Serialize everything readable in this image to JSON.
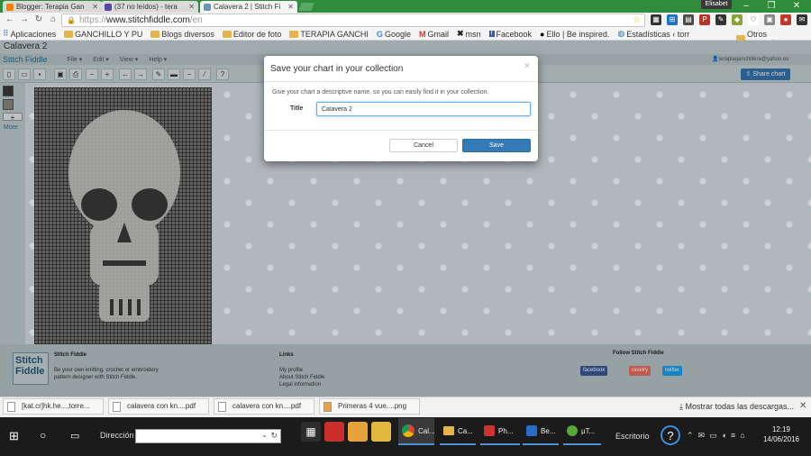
{
  "browser": {
    "tabs": [
      {
        "title": "Blogger: Terapia Gan",
        "color": "#f57d00"
      },
      {
        "title": "(37 no leídos) - tera",
        "color": "#5a46a8"
      },
      {
        "title": "Calavera 2 | Stitch Fi",
        "color": "#6a95b5"
      },
      {
        "title": "",
        "color": "#888"
      }
    ],
    "profile_name": "Elisabet",
    "url_scheme": "https://",
    "url_host": "www.stitchfiddle.com",
    "url_path": "/en",
    "bookmarks": [
      {
        "label": "Aplicaciones",
        "icon": "apps-icon"
      },
      {
        "label": "GANCHILLO Y PU",
        "icon": "folder-icon"
      },
      {
        "label": "Blogs diversos",
        "icon": "folder-icon"
      },
      {
        "label": "Editor de foto",
        "icon": "folder-icon"
      },
      {
        "label": "TERAPIA GANCHI",
        "icon": "folder-icon"
      },
      {
        "label": "Google",
        "icon": "google-icon"
      },
      {
        "label": "Gmail",
        "icon": "gmail-icon"
      },
      {
        "label": "msn",
        "icon": "msn-icon"
      },
      {
        "label": "Facebook",
        "icon": "facebook-icon"
      },
      {
        "label": "Ello | Be inspired.",
        "icon": "ello-icon"
      },
      {
        "label": "Estadísticas ‹ torr",
        "icon": "stats-icon"
      }
    ],
    "other_bookmarks": "Otros marcadores"
  },
  "app": {
    "chart_title": "Calavera 2",
    "logo": "Stitch Fiddle",
    "menus": [
      "File",
      "Edit",
      "View",
      "Help"
    ],
    "user_email": "terapiaganchillera@yahoo.es",
    "share_label": "Share chart",
    "more_label": "More",
    "plus_label": "+"
  },
  "footer": {
    "brand_heading": "Stitch Fiddle",
    "tagline_1": "Be your own knitting, crochet or embroidery",
    "tagline_2": "pattern designer with Stitch Fiddle.",
    "links_heading": "Links",
    "links": [
      "My profile",
      "About Stitch Fiddle",
      "Legal information"
    ],
    "follow_heading": "Follow Stitch Fiddle",
    "social": [
      "facebook",
      "ravelry",
      "twitter"
    ]
  },
  "dialog": {
    "title": "Save your chart in your collection",
    "close": "×",
    "help": "Give your chart a descriptive name, so you can easily find it in your collection.",
    "label": "Title",
    "value": "Calavera 2",
    "cancel": "Cancel",
    "save": "Save"
  },
  "downloads": {
    "items": [
      "[kat.cr]hk.he....torre...",
      "calavera con kn....pdf",
      "calavera con kn....pdf",
      "Primeras 4 vue....png"
    ],
    "show_all": "Mostrar todas las descargas..."
  },
  "taskbar": {
    "search_label": "Dirección",
    "apps": [
      "Cal...",
      "Ca...",
      "Ph...",
      "Be...",
      "µT..."
    ],
    "desktop_label": "Escritorio",
    "time": "12:19",
    "date": "14/06/2016"
  }
}
